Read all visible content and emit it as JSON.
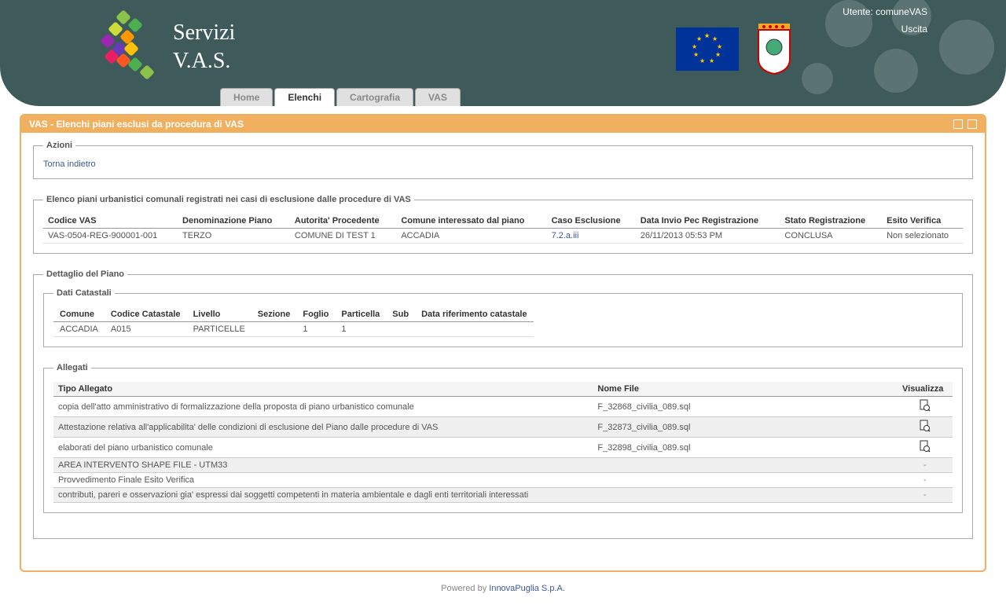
{
  "header": {
    "title_line1": "Servizi",
    "title_line2": "V.A.S.",
    "user_label": "Utente: comuneVAS",
    "logout": "Uscita"
  },
  "tabs": [
    {
      "label": "Home"
    },
    {
      "label": "Elenchi"
    },
    {
      "label": "Cartografia"
    },
    {
      "label": "VAS"
    }
  ],
  "page_title": "VAS - Elenchi piani esclusi da procedura di VAS",
  "azioni": {
    "legend": "Azioni",
    "back": "Torna indietro"
  },
  "elenco": {
    "legend": "Elenco piani urbanistici comunali registrati nei casi di esclusione dalle procedure di VAS",
    "headers": {
      "codice": "Codice VAS",
      "denom": "Denominazione Piano",
      "autorita": "Autorita' Procedente",
      "comune": "Comune interessato dal piano",
      "caso": "Caso Esclusione",
      "data": "Data Invio Pec Registrazione",
      "stato": "Stato Registrazione",
      "esito": "Esito Verifica"
    },
    "row": {
      "codice": "VAS-0504-REG-900001-001",
      "denom": "TERZO",
      "autorita": "COMUNE DI TEST 1",
      "comune": "ACCADIA",
      "caso": "7.2.a.iii",
      "data": "26/11/2013 05:53 PM",
      "stato": "CONCLUSA",
      "esito": "Non selezionato"
    }
  },
  "dettaglio": {
    "legend": "Dettaglio del Piano",
    "catastali": {
      "legend": "Dati Catastali",
      "headers": {
        "comune": "Comune",
        "codice": "Codice Catastale",
        "livello": "Livello",
        "sezione": "Sezione",
        "foglio": "Foglio",
        "particella": "Particella",
        "sub": "Sub",
        "data": "Data riferimento catastale"
      },
      "row": {
        "comune": "ACCADIA",
        "codice": "A015",
        "livello": "PARTICELLE",
        "sezione": "",
        "foglio": "1",
        "particella": "1",
        "sub": "",
        "data": ""
      }
    },
    "allegati": {
      "legend": "Allegati",
      "headers": {
        "tipo": "Tipo Allegato",
        "nome": "Nome File",
        "vis": "Visualizza"
      },
      "rows": [
        {
          "tipo": "copia dell'atto amministrativo di formalizzazione della proposta di piano urbanistico comunale",
          "nome": "F_32868_civilia_089.sql",
          "has_file": true
        },
        {
          "tipo": "Attestazione relativa all'applicabilita' delle condizioni di esclusione del Piano dalle procedure di VAS",
          "nome": "F_32873_civilia_089.sql",
          "has_file": true
        },
        {
          "tipo": "elaborati del piano urbanistico comunale",
          "nome": "F_32898_civilia_089.sql",
          "has_file": true
        },
        {
          "tipo": "AREA INTERVENTO SHAPE FILE - UTM33",
          "nome": "",
          "has_file": false
        },
        {
          "tipo": "Provvedimento Finale Esito Verifica",
          "nome": "",
          "has_file": false
        },
        {
          "tipo": "contributi, pareri e osservazioni gia' espressi dai soggetti competenti in materia ambientale e dagli enti territoriali interessati",
          "nome": "",
          "has_file": false
        }
      ]
    }
  },
  "footer": {
    "prefix": "Powered by ",
    "link": "InnovaPuglia S.p.A."
  }
}
